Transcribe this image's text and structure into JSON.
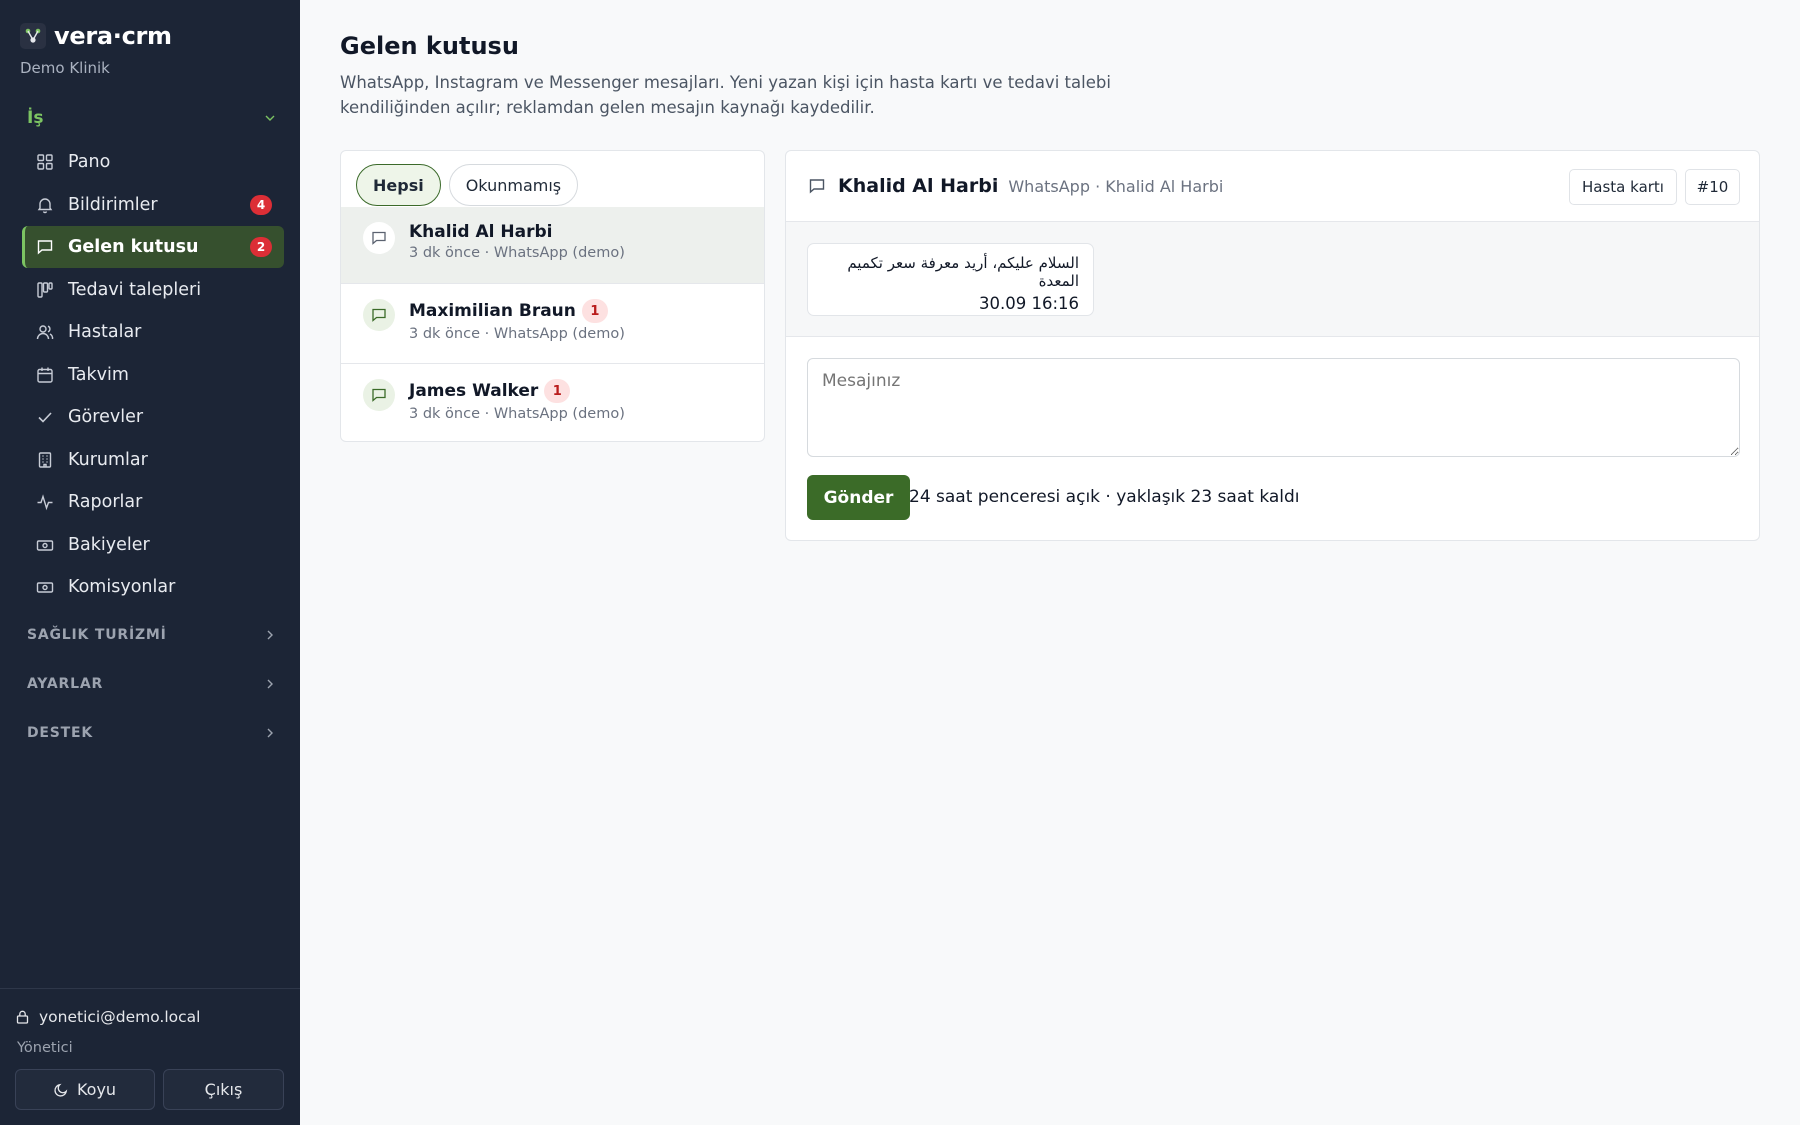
{
  "app": {
    "brand": "vera·crm",
    "clinic": "Demo Klinik"
  },
  "sidebar": {
    "open_section": "İş",
    "items": [
      {
        "label": "Pano",
        "icon": "grid-icon"
      },
      {
        "label": "Bildirimler",
        "icon": "bell-icon",
        "badge": "4"
      },
      {
        "label": "Gelen kutusu",
        "icon": "message-icon",
        "badge": "2",
        "active": true
      },
      {
        "label": "Tedavi talepleri",
        "icon": "kanban-icon"
      },
      {
        "label": "Hastalar",
        "icon": "users-icon"
      },
      {
        "label": "Takvim",
        "icon": "calendar-icon"
      },
      {
        "label": "Görevler",
        "icon": "check-icon"
      },
      {
        "label": "Kurumlar",
        "icon": "building-icon"
      },
      {
        "label": "Raporlar",
        "icon": "activity-icon"
      },
      {
        "label": "Bakiyeler",
        "icon": "banknote-icon"
      },
      {
        "label": "Komisyonlar",
        "icon": "banknote-icon"
      }
    ],
    "sections": [
      "SAĞLIK TURİZMİ",
      "AYARLAR",
      "DESTEK"
    ],
    "user_email": "yonetici@demo.local",
    "user_role": "Yönetici",
    "theme_button": "Koyu",
    "logout_button": "Çıkış"
  },
  "page": {
    "title": "Gelen kutusu",
    "description": "WhatsApp, Instagram ve Messenger mesajları. Yeni yazan kişi için hasta kartı ve tedavi talebi kendiliğinden açılır; reklamdan gelen mesajın kaynağı kaydedilir."
  },
  "filters": {
    "all": "Hepsi",
    "unread": "Okunmamış"
  },
  "conversations": [
    {
      "name": "Khalid Al Harbi",
      "meta": "3 dk önce · WhatsApp (demo)",
      "badge": ""
    },
    {
      "name": "Maximilian Braun",
      "meta": "3 dk önce · WhatsApp (demo)",
      "badge": "1"
    },
    {
      "name": "James Walker",
      "meta": "3 dk önce · WhatsApp (demo)",
      "badge": "1"
    }
  ],
  "chat": {
    "name": "Khalid Al Harbi",
    "subtitle": "WhatsApp · Khalid Al Harbi",
    "patient_card_button": "Hasta kartı",
    "ticket_button": "#10",
    "messages": [
      {
        "text": "السلام عليكم، أريد معرفة سعر تكميم المعدة",
        "time": "30.09 16:16"
      }
    ],
    "input_placeholder": "Mesajınız",
    "send_button": "Gönder",
    "window_note": "24 saat penceresi açık · yaklaşık 23 saat kaldı"
  },
  "colors": {
    "sidebar_bg": "#1c2536",
    "accent_green": "#3b6b28",
    "badge_red": "#dc2e36"
  }
}
